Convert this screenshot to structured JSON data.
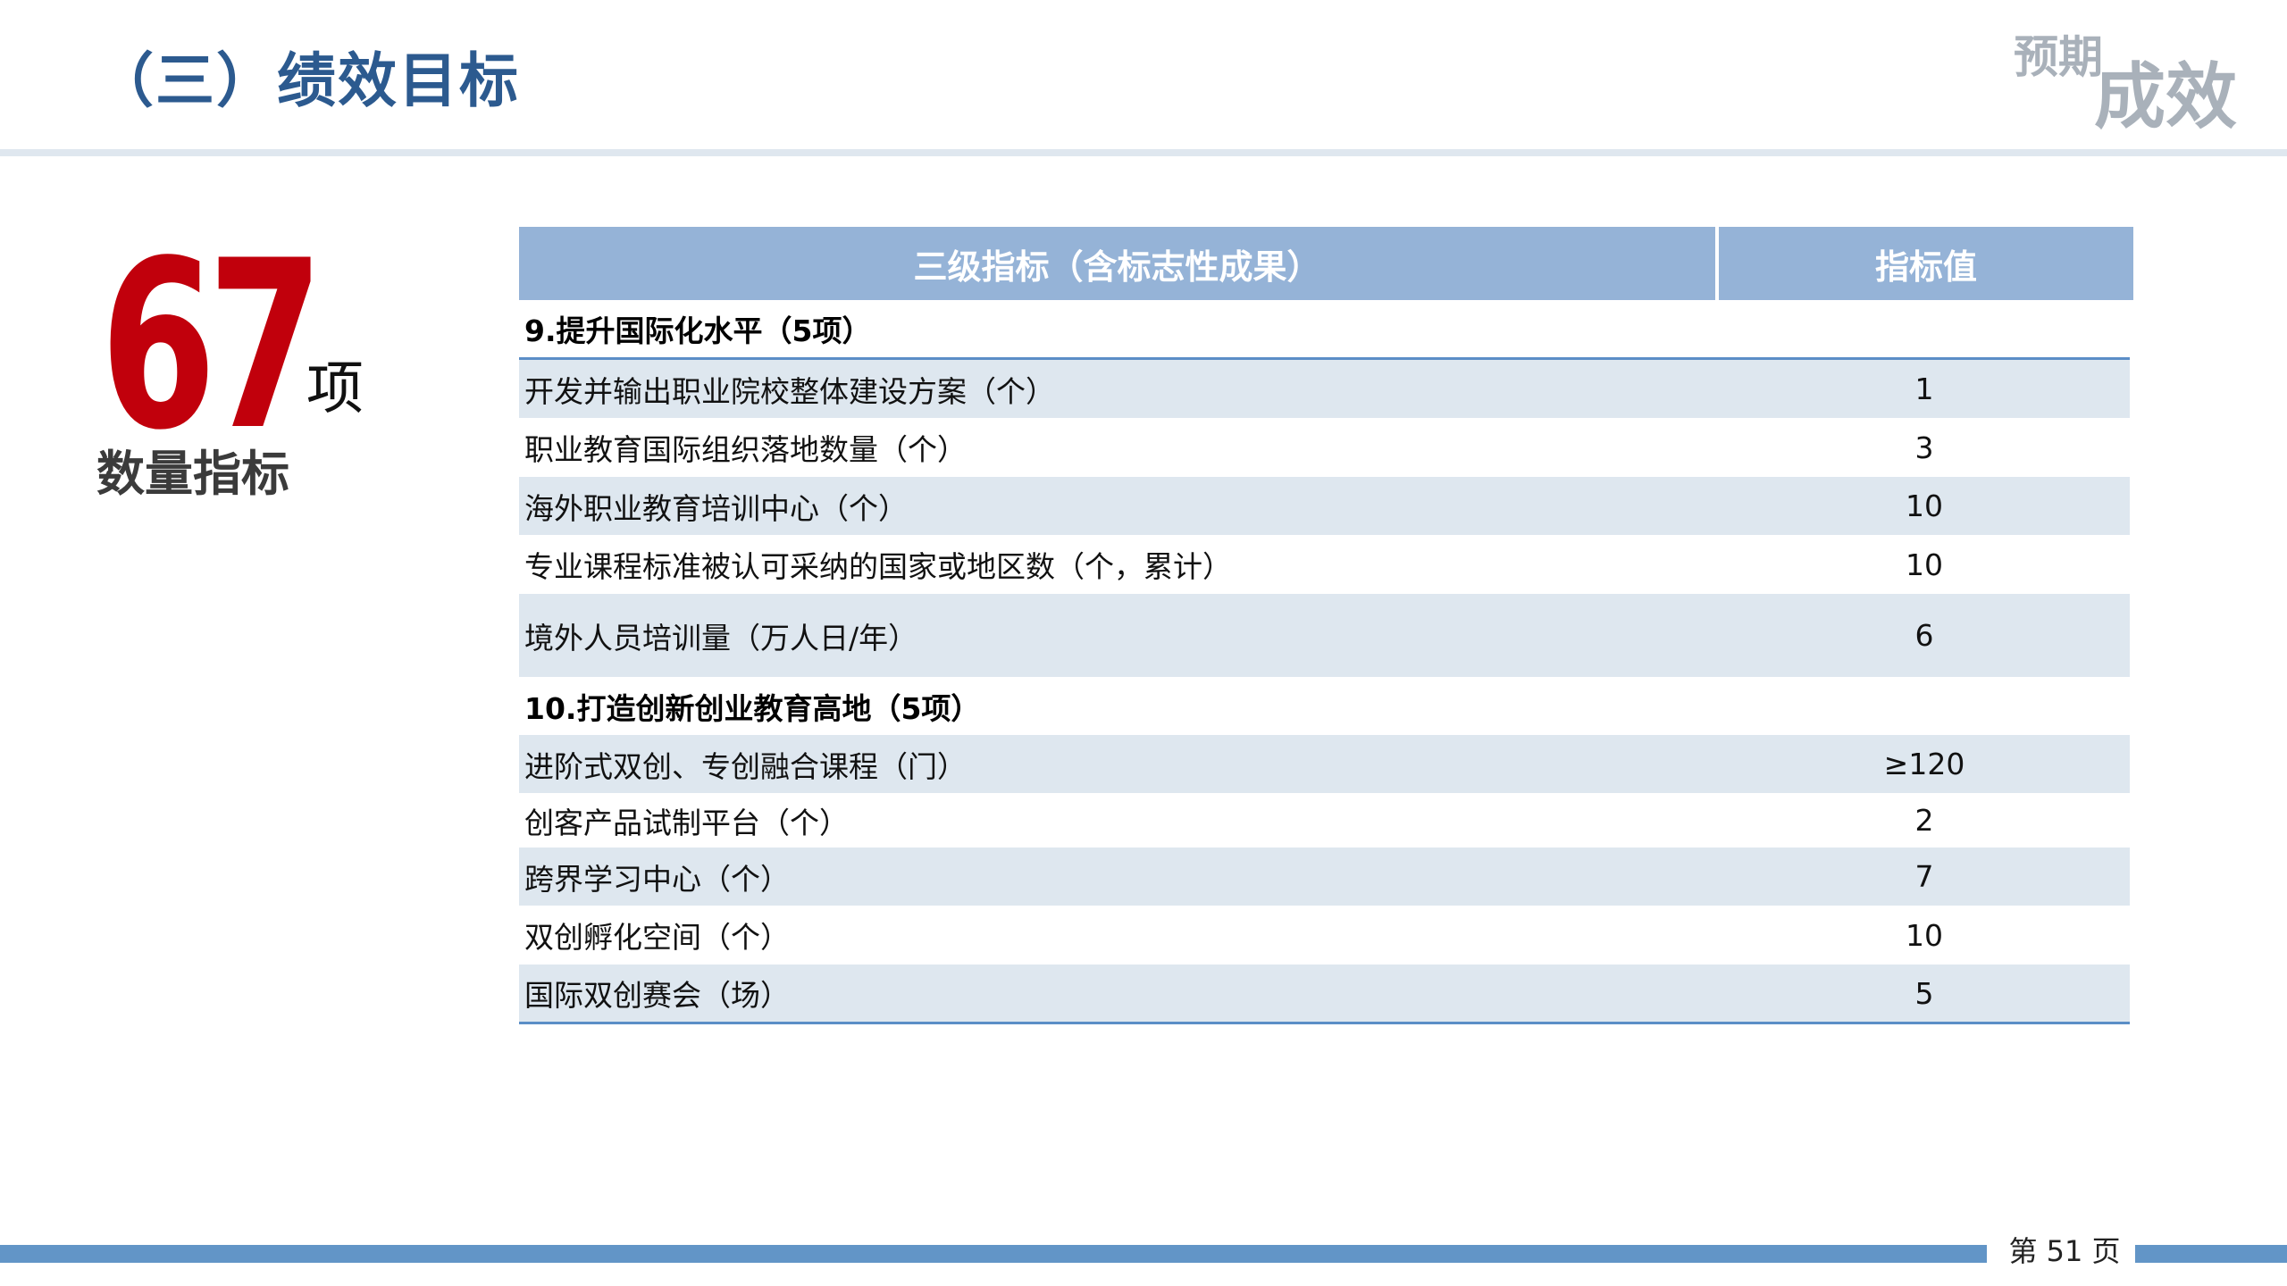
{
  "header": {
    "title": "（三）绩效目标",
    "corner_small": "预期",
    "corner_big": "成效"
  },
  "kpi": {
    "number": "67",
    "unit": "项",
    "label": "数量指标"
  },
  "table": {
    "columns": [
      "三级指标（含标志性成果）",
      "指标值"
    ],
    "rows": [
      {
        "kind": "section",
        "name": "9.提升国际化水平（5项）",
        "value": ""
      },
      {
        "kind": "item",
        "name": "开发并输出职业院校整体建设方案（个）",
        "value": "1"
      },
      {
        "kind": "item",
        "name": "职业教育国际组织落地数量（个）",
        "value": "3"
      },
      {
        "kind": "item",
        "name": "海外职业教育培训中心（个）",
        "value": "10"
      },
      {
        "kind": "item",
        "name": "专业课程标准被认可采纳的国家或地区数（个，累计）",
        "value": "10"
      },
      {
        "kind": "item",
        "name": "境外人员培训量（万人日/年）",
        "value": "6"
      },
      {
        "kind": "section",
        "name": "10.打造创新创业教育高地（5项）",
        "value": ""
      },
      {
        "kind": "item",
        "name": "进阶式双创、专创融合课程（门）",
        "value": "≥120"
      },
      {
        "kind": "item",
        "name": "创客产品试制平台（个）",
        "value": "2"
      },
      {
        "kind": "item",
        "name": "跨界学习中心（个）",
        "value": "7"
      },
      {
        "kind": "item",
        "name": "双创孵化空间（个）",
        "value": "10"
      },
      {
        "kind": "item",
        "name": "国际双创赛会（场）",
        "value": "5"
      }
    ]
  },
  "footer": {
    "page_label": "第 51 页"
  },
  "colors": {
    "title": "#2c5a8f",
    "kpi_red": "#c1000c",
    "table_header": "#95b3d7",
    "row_alt": "#dee7ef",
    "accent_blue": "#6295c7"
  }
}
